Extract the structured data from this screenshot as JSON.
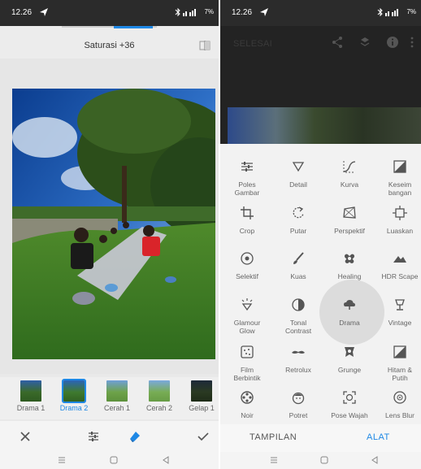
{
  "left": {
    "status": {
      "time": "12.26",
      "battery": "7%"
    },
    "header": {
      "title": "Saturasi +36"
    },
    "filters": [
      {
        "label": "Drama 1",
        "active": false
      },
      {
        "label": "Drama 2",
        "active": true
      },
      {
        "label": "Cerah 1",
        "active": false
      },
      {
        "label": "Cerah 2",
        "active": false
      },
      {
        "label": "Gelap 1",
        "active": false
      }
    ],
    "actions": {
      "cancel_icon": "close-icon",
      "adjust_icon": "sliders-icon",
      "style_icon": "style-icon",
      "apply_icon": "check-icon"
    }
  },
  "right": {
    "status": {
      "time": "12.26",
      "battery": "7%"
    },
    "header": {
      "done_label": "SELESAI"
    },
    "tools": [
      {
        "label": "Poles\nGambar",
        "icon": "tune-icon"
      },
      {
        "label": "Detail",
        "icon": "triangle-down-icon"
      },
      {
        "label": "Kurva",
        "icon": "curves-icon"
      },
      {
        "label": "Keseim\nbangan",
        "icon": "white-balance-icon"
      },
      {
        "label": "Crop",
        "icon": "crop-icon"
      },
      {
        "label": "Putar",
        "icon": "rotate-icon"
      },
      {
        "label": "Perspektif",
        "icon": "perspective-icon"
      },
      {
        "label": "Luaskan",
        "icon": "expand-icon"
      },
      {
        "label": "Selektif",
        "icon": "selective-icon"
      },
      {
        "label": "Kuas",
        "icon": "brush-icon"
      },
      {
        "label": "Healing",
        "icon": "healing-icon"
      },
      {
        "label": "HDR Scape",
        "icon": "mountains-icon"
      },
      {
        "label": "Glamour\nGlow",
        "icon": "glow-icon"
      },
      {
        "label": "Tonal\nContrast",
        "icon": "contrast-icon"
      },
      {
        "label": "Drama",
        "icon": "cloud-icon"
      },
      {
        "label": "Vintage",
        "icon": "lamp-icon"
      },
      {
        "label": "Film\nBerbintik",
        "icon": "film-grain-icon"
      },
      {
        "label": "Retrolux",
        "icon": "mustache-icon"
      },
      {
        "label": "Grunge",
        "icon": "grunge-icon"
      },
      {
        "label": "Hitam &\nPutih",
        "icon": "black-white-icon"
      },
      {
        "label": "Noir",
        "icon": "film-reel-icon"
      },
      {
        "label": "Potret",
        "icon": "face-icon"
      },
      {
        "label": "Pose Wajah",
        "icon": "face-pose-icon"
      },
      {
        "label": "Lens Blur",
        "icon": "lens-blur-icon"
      }
    ],
    "bottom_tabs": {
      "looks": "TAMPILAN",
      "tools": "ALAT"
    }
  },
  "colors": {
    "accent": "#1e88e5",
    "dark": "#232323",
    "panel": "#f2f2f2"
  }
}
